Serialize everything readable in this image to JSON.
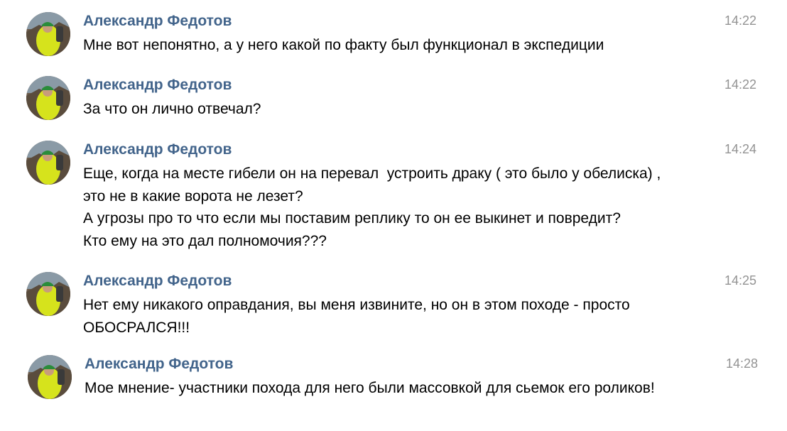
{
  "messages": [
    {
      "author": "Александр Федотов",
      "time": "14:22",
      "lines": [
        "Мне вот непонятно, а у него какой по факту был функционал в экспедиции"
      ]
    },
    {
      "author": "Александр Федотов",
      "time": "14:22",
      "lines": [
        "За что он лично отвечал?"
      ]
    },
    {
      "author": "Александр Федотов",
      "time": "14:24",
      "lines": [
        "Еще, когда на месте гибели он на перевал  устроить драку ( это было у обелиска) ,",
        "это не в какие ворота не лезет?",
        "А угрозы про то что если мы поставим реплику то он ее выкинет и повредит?",
        "Кто ему на это дал полномочия???"
      ]
    },
    {
      "author": "Александр Федотов",
      "time": "14:25",
      "lines": [
        "Нет ему никакого оправдания, вы меня извините, но он в этом походе - просто",
        "ОБОСРАЛСЯ!!!"
      ]
    },
    {
      "author": "Александр Федотов",
      "time": "14:28",
      "lines": [
        "Мое мнение- участники похода для него были массовкой для сьемок его роликов!"
      ]
    }
  ],
  "colors": {
    "author": "#42648b",
    "time": "#939393",
    "text": "#000000",
    "background": "#ffffff"
  },
  "icons": {
    "avatar": "user-avatar-photo"
  }
}
